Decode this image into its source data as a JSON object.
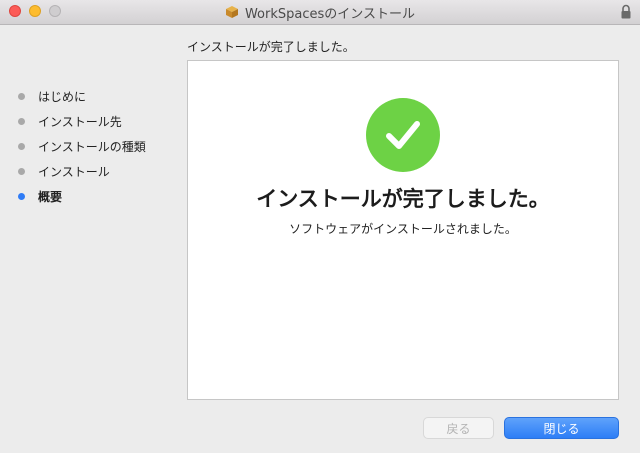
{
  "window": {
    "title": "WorkSpacesのインストール"
  },
  "header": {
    "subtitle": "インストールが完了しました。"
  },
  "sidebar": {
    "steps": [
      {
        "label": "はじめに",
        "active": false
      },
      {
        "label": "インストール先",
        "active": false
      },
      {
        "label": "インストールの種類",
        "active": false
      },
      {
        "label": "インストール",
        "active": false
      },
      {
        "label": "概要",
        "active": true
      }
    ]
  },
  "main": {
    "heading": "インストールが完了しました。",
    "message": "ソフトウェアがインストールされました。",
    "icon": "checkmark-icon",
    "accent": "#6dd245"
  },
  "buttons": {
    "back": "戻る",
    "close": "閉じる"
  },
  "colors": {
    "active_step": "#2f7cf6",
    "primary_button": "#2d7ef6"
  }
}
